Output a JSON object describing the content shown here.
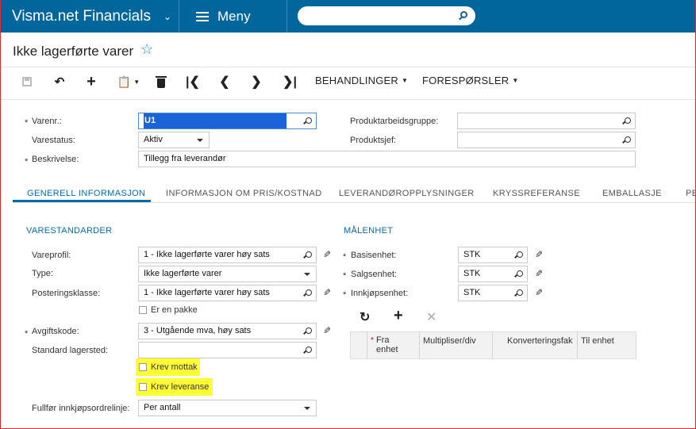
{
  "app": {
    "name": "Visma.net Financials",
    "menu_label": "Meny",
    "search_placeholder": ""
  },
  "page": {
    "title": "Ikke lagerførte varer"
  },
  "toolbar": {
    "actions_label": "BEHANDLINGER",
    "inquiries_label": "FORESPØRSLER"
  },
  "header": {
    "item_no_label": "Varenr.:",
    "item_no_value": "U1",
    "status_label": "Varestatus:",
    "status_value": "Aktiv",
    "description_label": "Beskrivelse:",
    "description_value": "Tillegg fra leverandør",
    "product_group_label": "Produktarbeidsgruppe:",
    "product_group_value": "",
    "product_manager_label": "Produktsjef:",
    "product_manager_value": "",
    "required_mark": "*"
  },
  "tabs": [
    {
      "label": "GENERELL INFORMASJON"
    },
    {
      "label": "INFORMASJON OM PRIS/KOSTNAD"
    },
    {
      "label": "LEVERANDØROPPLYSNINGER"
    },
    {
      "label": "KRYSSREFERANSE"
    },
    {
      "label": "EMBALLASJE"
    },
    {
      "label": "PE"
    }
  ],
  "defaults": {
    "section_title": "VARESTANDARDER",
    "item_class_label": "Vareprofil:",
    "item_class_value": "1 - Ikke lagerførte varer høy sats",
    "type_label": "Type:",
    "type_value": "Ikke lagerførte varer",
    "posting_class_label": "Posteringsklasse:",
    "posting_class_value": "1 - Ikke lagerførte varer høy sats",
    "is_kit_label": "Er en pakke",
    "tax_code_label": "Avgiftskode:",
    "tax_code_value": "3 - Utgående mva, høy sats",
    "default_warehouse_label": "Standard lagersted:",
    "default_warehouse_value": "",
    "require_receipt_label": "Krev mottak",
    "require_shipment_label": "Krev leveranse",
    "complete_po_line_label": "Fullfør innkjøpsordrelinje:",
    "complete_po_line_value": "Per antall"
  },
  "uom": {
    "section_title": "MÅLENHET",
    "base_unit_label": "Basisenhet:",
    "base_unit_value": "STK",
    "sales_unit_label": "Salgsenhet:",
    "sales_unit_value": "STK",
    "purchase_unit_label": "Innkjøpsenhet:",
    "purchase_unit_value": "STK",
    "grid_columns": [
      {
        "label": "Fra enhet"
      },
      {
        "label": "Multipliser/div"
      },
      {
        "label": "Konverteringsfak"
      },
      {
        "label": "Til enhet"
      }
    ]
  },
  "colors": {
    "topbar": "#00669c",
    "accent": "#0a6aa6",
    "highlight": "#ffff33"
  }
}
